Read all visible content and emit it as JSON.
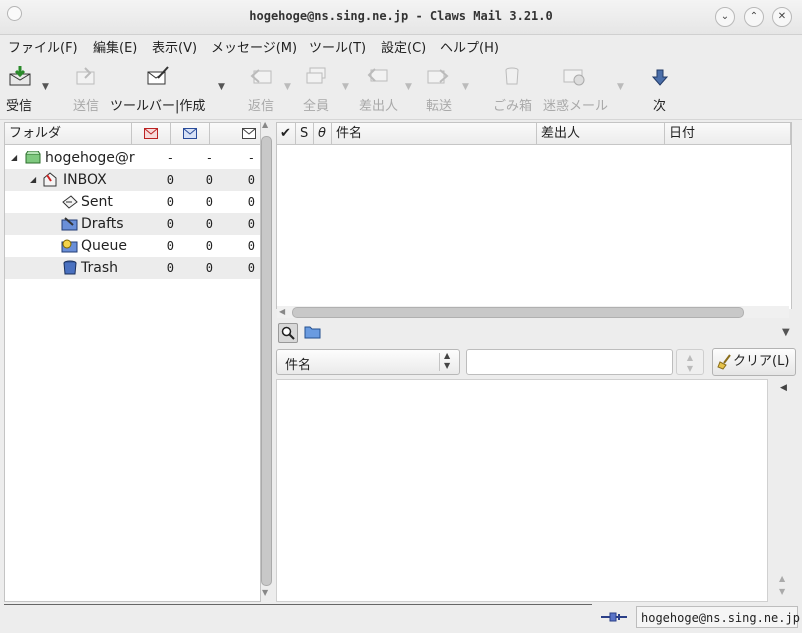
{
  "window": {
    "title": "hogehoge@ns.sing.ne.jp - Claws Mail 3.21.0",
    "minimize_icon": "chevron-down-icon",
    "maximize_icon": "chevron-up-icon",
    "close_icon": "close-icon"
  },
  "menu": [
    {
      "label": "ファイル(F)"
    },
    {
      "label": "編集(E)"
    },
    {
      "label": "表示(V)"
    },
    {
      "label": "メッセージ(M)"
    },
    {
      "label": "ツール(T)"
    },
    {
      "label": "設定(C)"
    },
    {
      "label": "ヘルプ(H)"
    }
  ],
  "toolbar": {
    "receive": "受信",
    "send": "送信",
    "compose": "ツールバー|作成",
    "reply": "返信",
    "reply_all": "全員",
    "reply_sender": "差出人",
    "forward": "転送",
    "trash": "ごみ箱",
    "spam": "迷惑メール",
    "next": "次"
  },
  "folder_pane": {
    "columns": {
      "folder": "フォルダ"
    },
    "rows": [
      {
        "name": "hogehoge@r",
        "new": "-",
        "unread": "-",
        "total": "-",
        "icon": "mailbox-icon"
      },
      {
        "name": "INBOX",
        "new": "0",
        "unread": "0",
        "total": "0",
        "icon": "inbox-icon"
      },
      {
        "name": "Sent",
        "new": "0",
        "unread": "0",
        "total": "0",
        "icon": "sent-icon"
      },
      {
        "name": "Drafts",
        "new": "0",
        "unread": "0",
        "total": "0",
        "icon": "drafts-icon"
      },
      {
        "name": "Queue",
        "new": "0",
        "unread": "0",
        "total": "0",
        "icon": "queue-icon"
      },
      {
        "name": "Trash",
        "new": "0",
        "unread": "0",
        "total": "0",
        "icon": "trash-icon"
      }
    ]
  },
  "message_list": {
    "columns": {
      "mark": "✔",
      "status": "S",
      "attachment": "θ",
      "subject": "件名",
      "from": "差出人",
      "date": "日付"
    }
  },
  "quicksearch": {
    "field": "件名",
    "value": "",
    "clear": "クリア(L)"
  },
  "status": {
    "account": "hogehoge@ns.sing.ne.jp"
  }
}
